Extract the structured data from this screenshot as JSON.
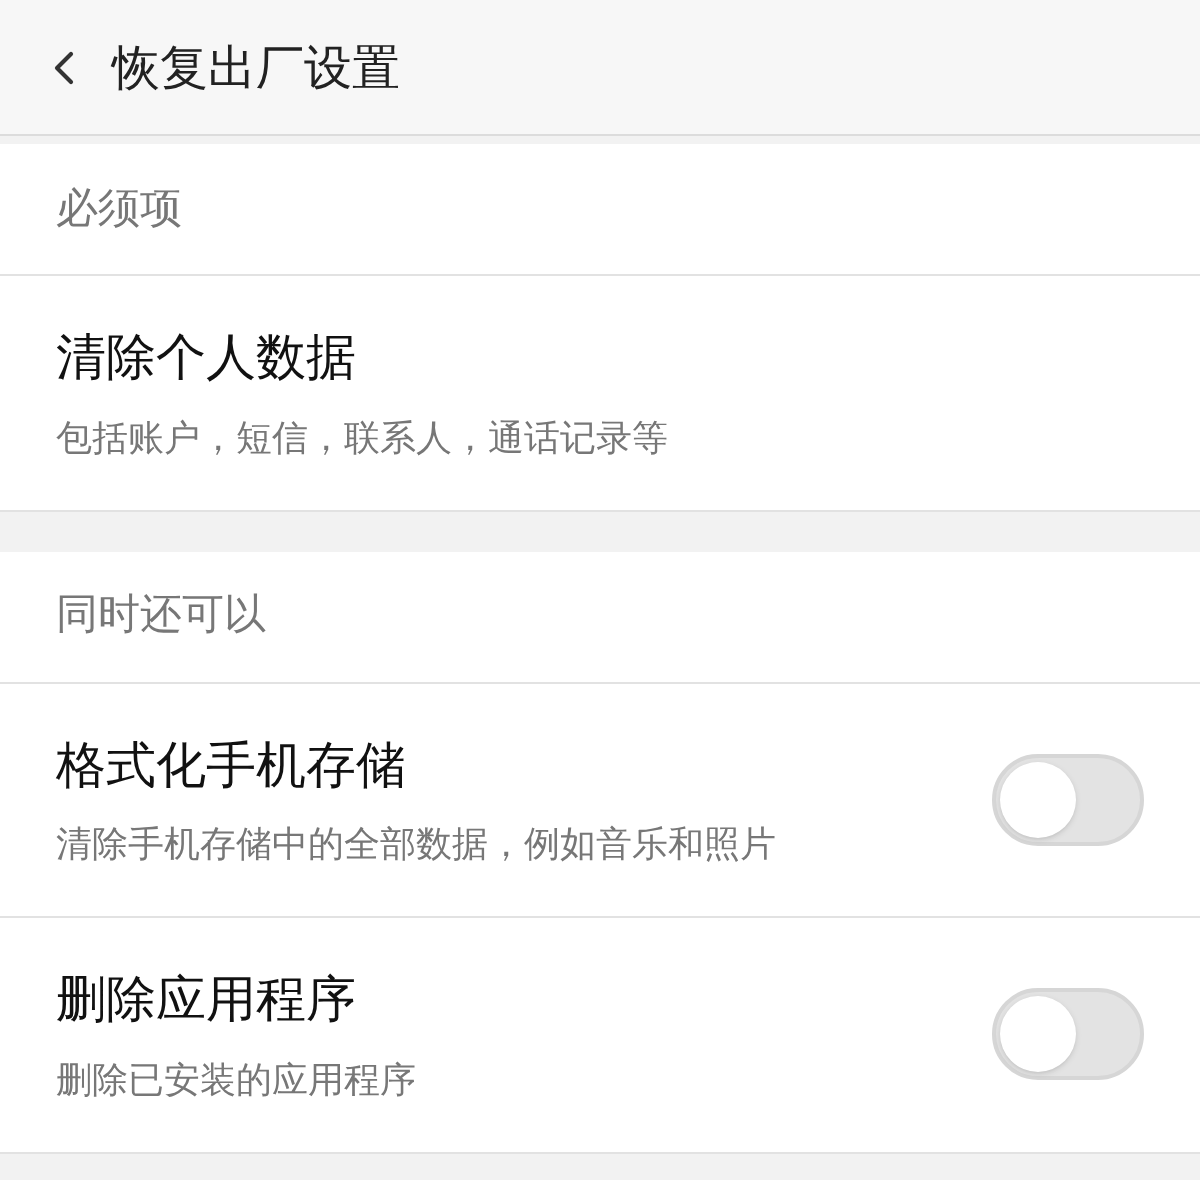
{
  "header": {
    "title": "恢复出厂设置"
  },
  "sections": [
    {
      "title": "必须项",
      "items": [
        {
          "kind": "plain",
          "title": "清除个人数据",
          "subtitle": "包括账户，短信，联系人，通话记录等"
        }
      ]
    },
    {
      "title": "同时还可以",
      "items": [
        {
          "kind": "toggle",
          "title": "格式化手机存储",
          "subtitle": "清除手机存储中的全部数据，例如音乐和照片",
          "on": false
        },
        {
          "kind": "toggle",
          "title": "删除应用程序",
          "subtitle": "删除已安装的应用程序",
          "on": false
        }
      ]
    }
  ]
}
